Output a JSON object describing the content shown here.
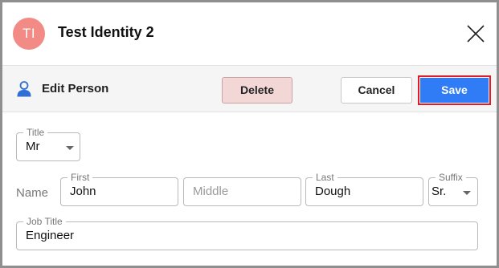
{
  "header": {
    "avatar_initials": "TI",
    "avatar_color": "#f28a85",
    "title": "Test Identity 2",
    "close_icon": "close-icon"
  },
  "toolbar": {
    "icon": "person-icon",
    "label": "Edit Person",
    "delete_label": "Delete",
    "cancel_label": "Cancel",
    "save_label": "Save",
    "save_color": "#2f7cf6",
    "highlight_color": "#e01b24"
  },
  "form": {
    "title": {
      "label": "Title",
      "value": "Mr"
    },
    "name_label": "Name",
    "first": {
      "label": "First",
      "value": "John"
    },
    "middle": {
      "placeholder": "Middle"
    },
    "last": {
      "label": "Last",
      "value": "Dough"
    },
    "suffix": {
      "label": "Suffix",
      "value": "Sr."
    },
    "job_title": {
      "label": "Job Title",
      "value": "Engineer"
    }
  }
}
